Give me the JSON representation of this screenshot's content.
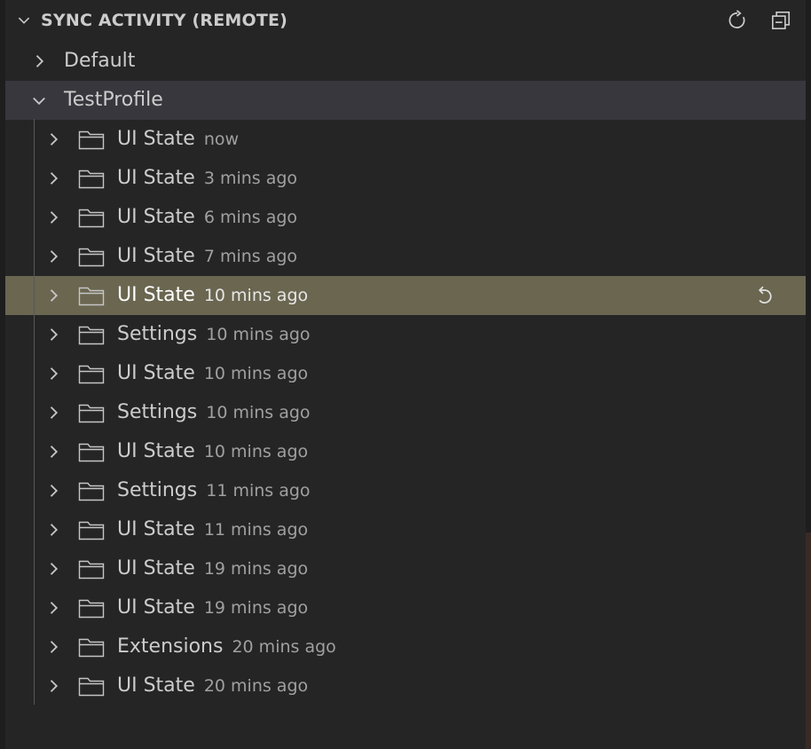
{
  "header": {
    "title": "SYNC ACTIVITY (REMOTE)",
    "chevron_icon": "chevron-down-icon",
    "refresh_icon": "refresh-icon",
    "collapse_icon": "collapse-all-icon"
  },
  "profiles": [
    {
      "label": "Default",
      "expanded": false
    },
    {
      "label": "TestProfile",
      "expanded": true
    }
  ],
  "entries": [
    {
      "name": "UI State",
      "time": "now"
    },
    {
      "name": "UI State",
      "time": "3 mins ago"
    },
    {
      "name": "UI State",
      "time": "6 mins ago"
    },
    {
      "name": "UI State",
      "time": "7 mins ago"
    },
    {
      "name": "UI State",
      "time": "10 mins ago",
      "selected": true,
      "action_icon": "restore-icon"
    },
    {
      "name": "Settings",
      "time": "10 mins ago"
    },
    {
      "name": "UI State",
      "time": "10 mins ago"
    },
    {
      "name": "Settings",
      "time": "10 mins ago"
    },
    {
      "name": "UI State",
      "time": "10 mins ago"
    },
    {
      "name": "Settings",
      "time": "11 mins ago"
    },
    {
      "name": "UI State",
      "time": "11 mins ago"
    },
    {
      "name": "UI State",
      "time": "19 mins ago"
    },
    {
      "name": "UI State",
      "time": "19 mins ago"
    },
    {
      "name": "Extensions",
      "time": "20 mins ago"
    },
    {
      "name": "UI State",
      "time": "20 mins ago"
    }
  ],
  "colors": {
    "background": "#252526",
    "selected": "#6a6650",
    "expanded_row": "#37373d",
    "text": "#cccccc",
    "description": "#a0a0a0"
  }
}
